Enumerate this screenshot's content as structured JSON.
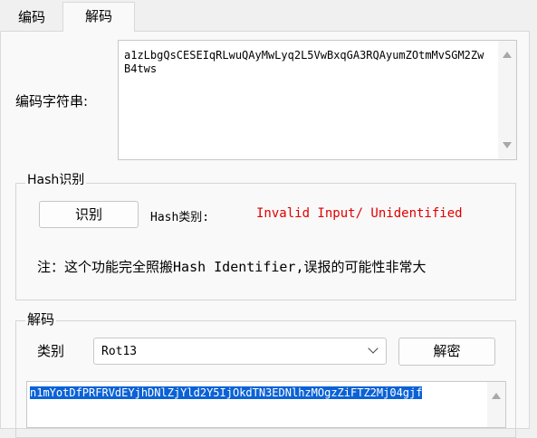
{
  "tabs": [
    {
      "label": "编码",
      "active": false
    },
    {
      "label": "解码",
      "active": true
    }
  ],
  "encoded": {
    "label": "编码字符串:",
    "value": "a1zLbgQsCESEIqRLwuQAyMwLyq2L5VwBxqGA3RQAyumZOtmMvSGM2ZwB4tws"
  },
  "hash_section": {
    "title": "Hash识别",
    "identify_button": "识别",
    "type_label": "Hash类别:",
    "result": "Invalid Input/ Unidentified",
    "note": "注：这个功能完全照搬Hash Identifier,误报的可能性非常大"
  },
  "decode_section": {
    "title": "解码",
    "type_label": "类别",
    "type_value": "Rot13",
    "decrypt_button": "解密",
    "output": "n1mYotDfPRFRVdEYjhDNlZjYld2Y5IjOkdTN3EDNlhzMOgzZiFTZ2Mj04gjf"
  },
  "colors": {
    "error_text": "#e00000",
    "selection": "#0b62d6",
    "background": "#f0f0f0"
  }
}
